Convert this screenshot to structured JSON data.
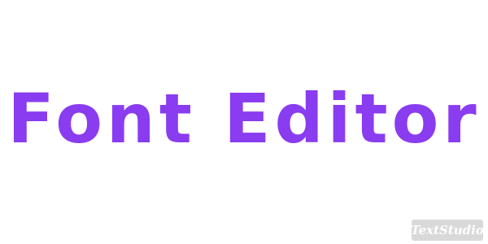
{
  "headline": {
    "text": "Font Editor",
    "color": "#8a3cf0"
  },
  "watermark": {
    "text": "TextStudio",
    "background": "#d9d9d9",
    "color": "#ffffff"
  },
  "page": {
    "background": "#ffffff"
  }
}
